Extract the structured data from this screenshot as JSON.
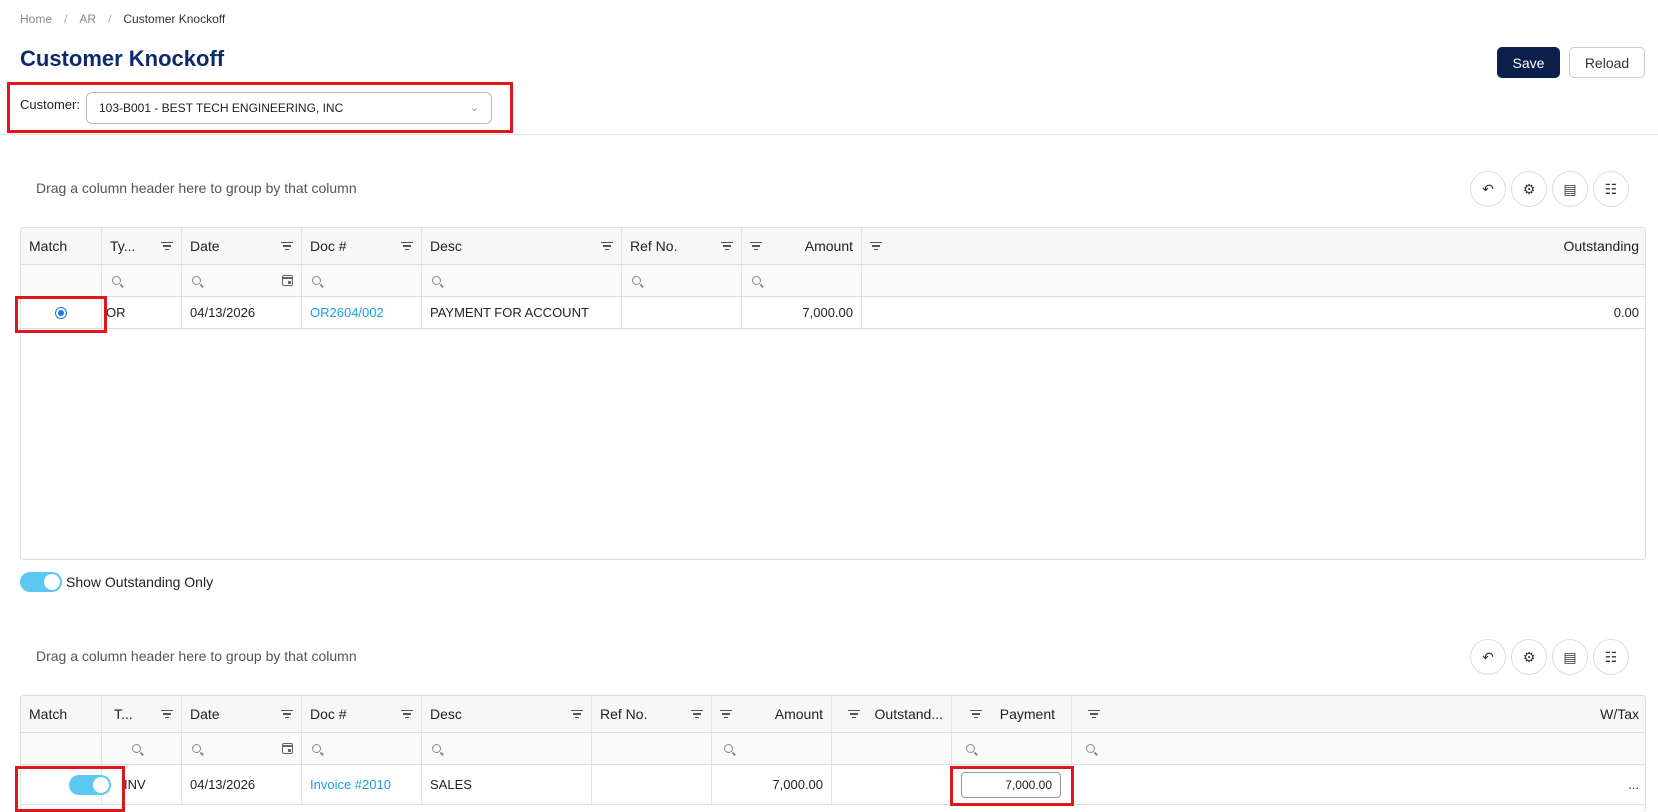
{
  "breadcrumb": {
    "items": [
      "Home",
      "AR"
    ],
    "current": "Customer Knockoff"
  },
  "page": {
    "title": "Customer Knockoff"
  },
  "actions": {
    "save": "Save",
    "reload": "Reload"
  },
  "customer": {
    "label": "Customer:",
    "value": "103-B001 - BEST TECH ENGINEERING, INC"
  },
  "grid1": {
    "group_hint": "Drag a column header here to group by that column",
    "columns": [
      "Match",
      "Ty...",
      "Date",
      "Doc #",
      "Desc",
      "Ref No.",
      "Amount",
      "Outstanding"
    ],
    "rows": [
      {
        "match": "selected",
        "type": "OR",
        "date": "04/13/2026",
        "doc": "OR2604/002",
        "desc": "PAYMENT FOR ACCOUNT",
        "ref": "",
        "amount": "7,000.00",
        "outstanding": "0.00"
      }
    ]
  },
  "show_outstanding": {
    "label": "Show Outstanding Only",
    "on": true
  },
  "grid2": {
    "group_hint": "Drag a column header here to group by that column",
    "columns": [
      "Match",
      "T...",
      "Date",
      "Doc #",
      "Desc",
      "Ref No.",
      "Amount",
      "Outstand...",
      "Payment",
      "W/Tax"
    ],
    "rows": [
      {
        "match": "on",
        "type": "INV",
        "date": "04/13/2026",
        "doc": "Invoice #2010",
        "desc": "SALES",
        "ref": "",
        "amount": "7,000.00",
        "outstanding": "",
        "payment": "7,000.00",
        "wtax": "..."
      }
    ]
  },
  "toolbar": {
    "icons": [
      "undo-icon",
      "gear-icon",
      "column-chooser-icon",
      "export-icon"
    ]
  },
  "colors": {
    "accent": "#0b1f4a",
    "title": "#0d2a6b",
    "link": "#1aa3e0",
    "toggle": "#5ac8f0",
    "highlight": "#e0161b"
  }
}
